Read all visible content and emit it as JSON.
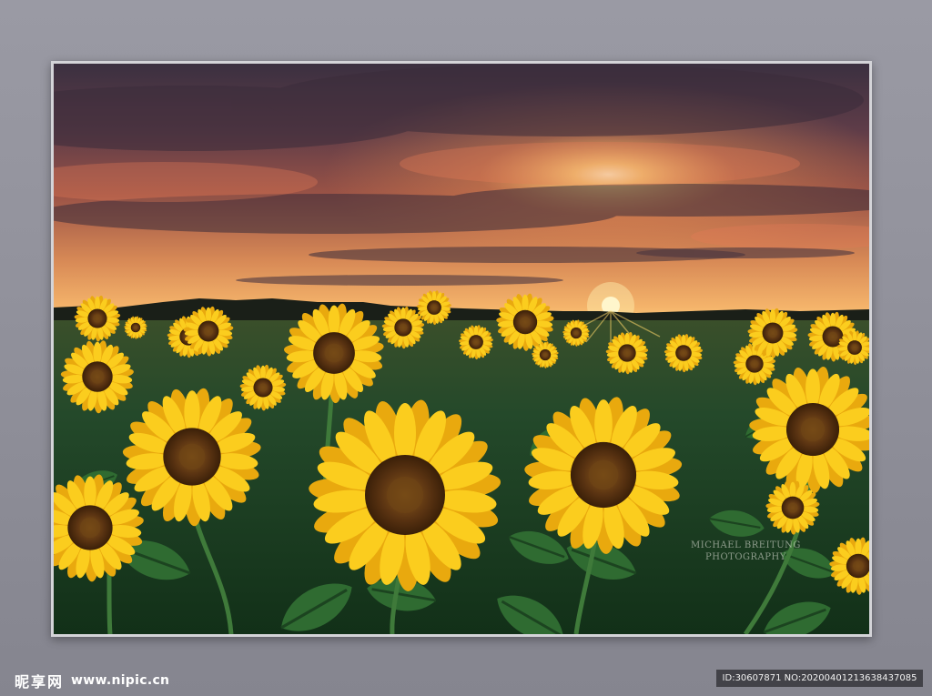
{
  "photo_credit": {
    "line1": "MICHAEL BREITUNG",
    "line2": "PHOTOGRAPHY"
  },
  "watermark": {
    "logo": "昵享网",
    "url": "www.nipic.cn"
  },
  "image_id": "ID:30607871 NO:20200401213638437085",
  "colors": {
    "background": "#8f8f99",
    "frame_border": "#d4d4d8",
    "sky_top": "#3f3240",
    "sky_glow": "#ffd27a",
    "petal": "#f8c81a",
    "flower_center": "#5b3412",
    "foliage": "#1f4a22"
  }
}
